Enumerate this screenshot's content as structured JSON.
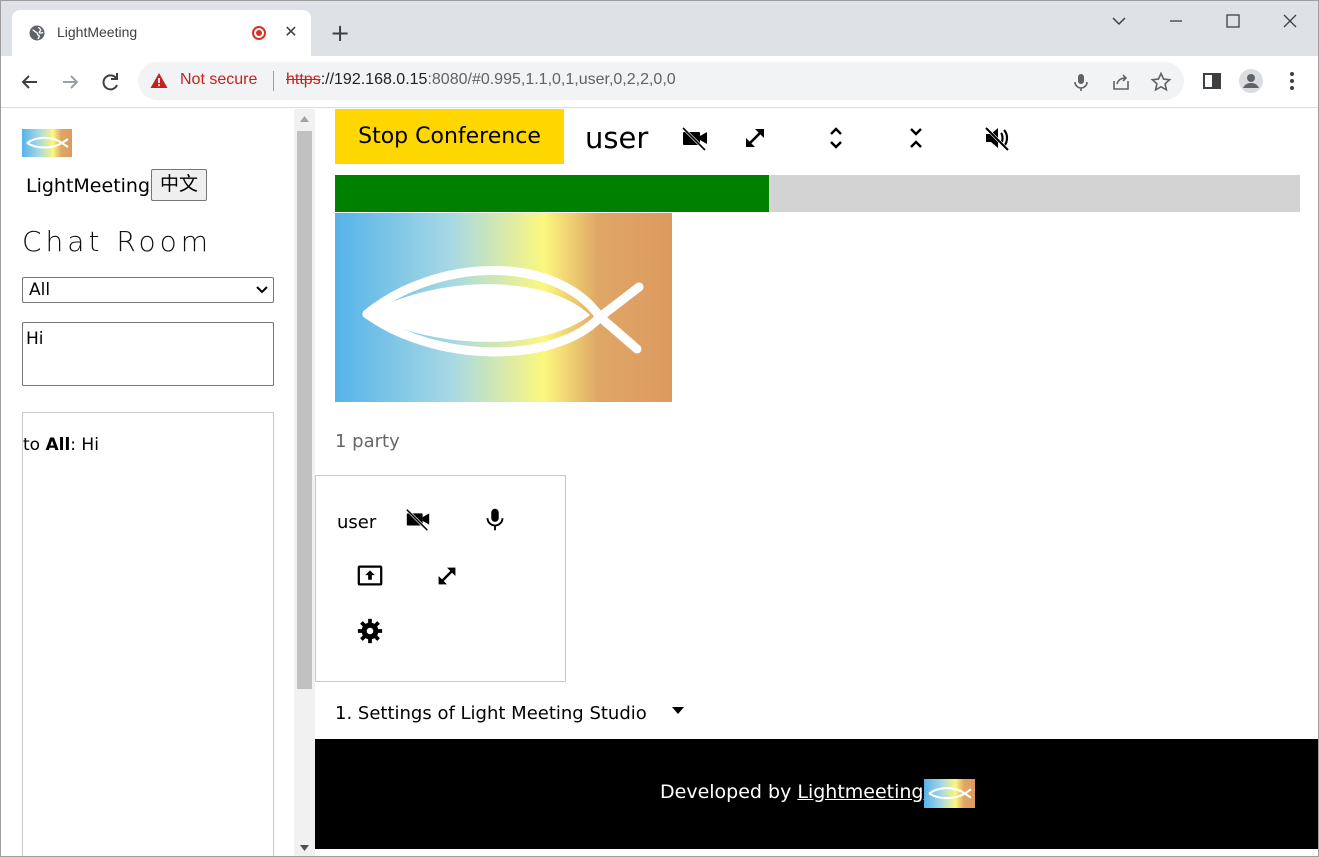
{
  "browser": {
    "tab_title": "LightMeeting",
    "tab_close": "✕",
    "new_tab": "+",
    "not_secure": "Not secure",
    "url_scheme": "https",
    "url_host": "://192.168.0.15",
    "url_rest": ":8080/#0.995,1.1,0,1,user,0,2,2,0,0"
  },
  "sidebar": {
    "brand": "LightMeeting",
    "lang_button": "中文",
    "title": "Chat Room",
    "recipient_selected": "All",
    "message_value": "Hi",
    "log": {
      "prefix": "to ",
      "target": "All",
      "text": ": Hi"
    }
  },
  "main": {
    "stop_button": "Stop Conference",
    "user_name": "user",
    "progress_fraction": 0.45,
    "party_count": "1 party",
    "party_user": "user",
    "settings_label": "1. Settings of Light Meeting Studio",
    "footer_prefix": "Developed by ",
    "footer_link": "Lightmeeting"
  },
  "icons": {
    "video_off": "videocam-off-icon",
    "expand": "expand-icon",
    "unfold": "unfold-more-icon",
    "fold": "unfold-less-icon",
    "mute": "volume-off-icon",
    "mic": "mic-icon",
    "screen_share": "screen-share-icon",
    "settings": "gear-icon"
  },
  "colors": {
    "stop_button": "#ffd700",
    "progress_fill": "#008000",
    "progress_track": "#d3d3d3",
    "not_secure": "#c5221f",
    "footer_bg": "#000000"
  }
}
